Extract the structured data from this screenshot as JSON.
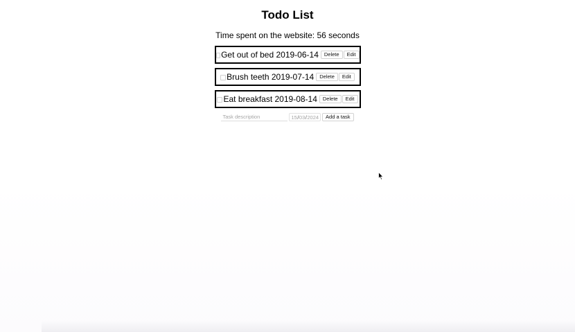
{
  "title": "Todo List",
  "timer_text": "Time spent on the website: 56 seconds",
  "todos": [
    {
      "text": "Get out of bed 2019-06-14",
      "checked": false,
      "delete_label": "Delete",
      "edit_label": "Edit"
    },
    {
      "text": "Brush teeth 2019-07-14",
      "checked": false,
      "delete_label": "Delete",
      "edit_label": "Edit"
    },
    {
      "text": "Eat breakfast 2019-08-14",
      "checked": false,
      "delete_label": "Delete",
      "edit_label": "Edit"
    }
  ],
  "add_form": {
    "description_placeholder": "Task description",
    "description_value": "",
    "date": {
      "day": "15",
      "month": "03",
      "year": "2024",
      "separator": "/"
    },
    "add_label": "Add a task"
  },
  "icons": {
    "cursor": "mouse-pointer-icon"
  },
  "colors": {
    "border": "#000000",
    "button_border": "#d2d2d2",
    "placeholder": "#a5a5a5"
  }
}
